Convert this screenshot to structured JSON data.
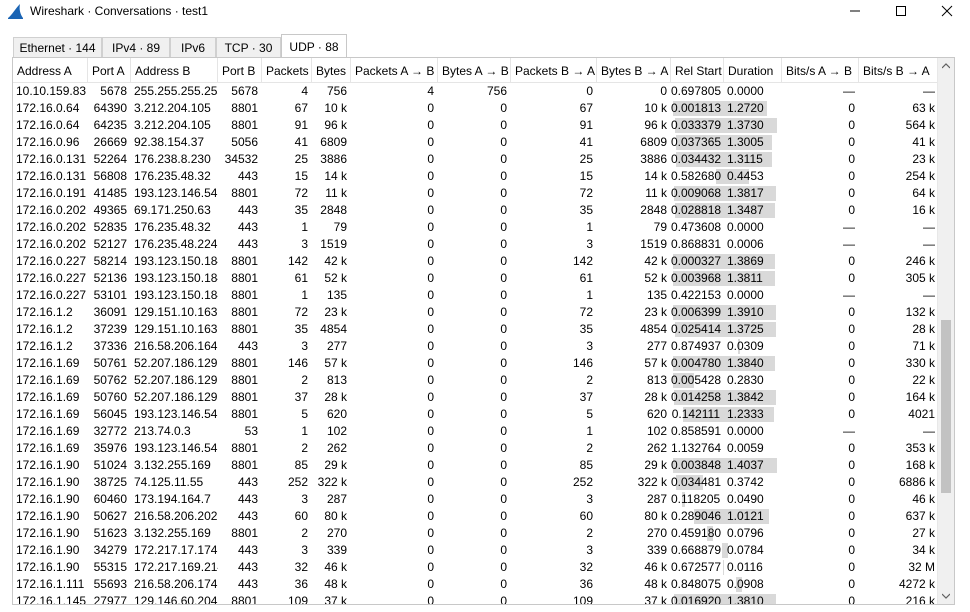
{
  "window": {
    "title": "Wireshark · Conversations · test1",
    "minimize_glyph": "—",
    "maximize_glyph": "☐",
    "close_glyph": "✕",
    "icon": "wireshark-fin-icon",
    "accent": "#1a64b4"
  },
  "tabs": [
    {
      "label": "Ethernet · 144",
      "active": false
    },
    {
      "label": "IPv4 · 89",
      "active": false
    },
    {
      "label": "IPv6",
      "active": false
    },
    {
      "label": "TCP · 30",
      "active": false
    },
    {
      "label": "UDP · 88",
      "active": true
    }
  ],
  "table": {
    "columns": [
      "Address A",
      "Port A",
      "Address B",
      "Port B",
      "Packets",
      "Bytes",
      "Packets A → B",
      "Bytes A → B",
      "Packets B → A",
      "Bytes B → A",
      "Rel Start",
      "Duration",
      "Bits/s A → B",
      "Bits/s B → A"
    ],
    "rows": [
      [
        "10.10.159.83",
        "5678",
        "255.255.255.255",
        "5678",
        "4",
        "756",
        "4",
        "756",
        "0",
        "0",
        "0.697805",
        "0.0000",
        "—",
        "—"
      ],
      [
        "172.16.0.64",
        "64390",
        "3.212.204.105",
        "8801",
        "67",
        "10 k",
        "0",
        "0",
        "67",
        "10 k",
        "0.001813",
        "1.2720",
        "0",
        "63 k"
      ],
      [
        "172.16.0.64",
        "64235",
        "3.212.204.105",
        "8801",
        "91",
        "96 k",
        "0",
        "0",
        "91",
        "96 k",
        "0.033379",
        "1.3730",
        "0",
        "564 k"
      ],
      [
        "172.16.0.96",
        "26669",
        "92.38.154.37",
        "5056",
        "41",
        "6809",
        "0",
        "0",
        "41",
        "6809",
        "0.037365",
        "1.3005",
        "0",
        "41 k"
      ],
      [
        "172.16.0.131",
        "52264",
        "176.238.8.230",
        "34532",
        "25",
        "3886",
        "0",
        "0",
        "25",
        "3886",
        "0.034432",
        "1.3115",
        "0",
        "23 k"
      ],
      [
        "172.16.0.131",
        "56808",
        "176.235.48.32",
        "443",
        "15",
        "14 k",
        "0",
        "0",
        "15",
        "14 k",
        "0.582680",
        "0.4453",
        "0",
        "254 k"
      ],
      [
        "172.16.0.191",
        "41485",
        "193.123.146.54",
        "8801",
        "72",
        "11 k",
        "0",
        "0",
        "72",
        "11 k",
        "0.009068",
        "1.3817",
        "0",
        "64 k"
      ],
      [
        "172.16.0.202",
        "49365",
        "69.171.250.63",
        "443",
        "35",
        "2848",
        "0",
        "0",
        "35",
        "2848",
        "0.028818",
        "1.3487",
        "0",
        "16 k"
      ],
      [
        "172.16.0.202",
        "52835",
        "176.235.48.32",
        "443",
        "1",
        "79",
        "0",
        "0",
        "1",
        "79",
        "0.473608",
        "0.0000",
        "—",
        "—"
      ],
      [
        "172.16.0.202",
        "52127",
        "176.235.48.224",
        "443",
        "3",
        "1519",
        "0",
        "0",
        "3",
        "1519",
        "0.868831",
        "0.0006",
        "—",
        "—"
      ],
      [
        "172.16.0.227",
        "58214",
        "193.123.150.184",
        "8801",
        "142",
        "42 k",
        "0",
        "0",
        "142",
        "42 k",
        "0.000327",
        "1.3869",
        "0",
        "246 k"
      ],
      [
        "172.16.0.227",
        "52136",
        "193.123.150.184",
        "8801",
        "61",
        "52 k",
        "0",
        "0",
        "61",
        "52 k",
        "0.003968",
        "1.3811",
        "0",
        "305 k"
      ],
      [
        "172.16.0.227",
        "53101",
        "193.123.150.184",
        "8801",
        "1",
        "135",
        "0",
        "0",
        "1",
        "135",
        "0.422153",
        "0.0000",
        "—",
        "—"
      ],
      [
        "172.16.1.2",
        "36091",
        "129.151.10.163",
        "8801",
        "72",
        "23 k",
        "0",
        "0",
        "72",
        "23 k",
        "0.006399",
        "1.3910",
        "0",
        "132 k"
      ],
      [
        "172.16.1.2",
        "37239",
        "129.151.10.163",
        "8801",
        "35",
        "4854",
        "0",
        "0",
        "35",
        "4854",
        "0.025414",
        "1.3725",
        "0",
        "28 k"
      ],
      [
        "172.16.1.2",
        "37336",
        "216.58.206.164",
        "443",
        "3",
        "277",
        "0",
        "0",
        "3",
        "277",
        "0.874937",
        "0.0309",
        "0",
        "71 k"
      ],
      [
        "172.16.1.69",
        "50761",
        "52.207.186.129",
        "8801",
        "146",
        "57 k",
        "0",
        "0",
        "146",
        "57 k",
        "0.004780",
        "1.3840",
        "0",
        "330 k"
      ],
      [
        "172.16.1.69",
        "50762",
        "52.207.186.129",
        "8801",
        "2",
        "813",
        "0",
        "0",
        "2",
        "813",
        "0.005428",
        "0.2830",
        "0",
        "22 k"
      ],
      [
        "172.16.1.69",
        "50760",
        "52.207.186.129",
        "8801",
        "37",
        "28 k",
        "0",
        "0",
        "37",
        "28 k",
        "0.014258",
        "1.3842",
        "0",
        "164 k"
      ],
      [
        "172.16.1.69",
        "56045",
        "193.123.146.54",
        "8801",
        "5",
        "620",
        "0",
        "0",
        "5",
        "620",
        "0.142111",
        "1.2333",
        "0",
        "4021"
      ],
      [
        "172.16.1.69",
        "32772",
        "213.74.0.3",
        "53",
        "1",
        "102",
        "0",
        "0",
        "1",
        "102",
        "0.858591",
        "0.0000",
        "—",
        "—"
      ],
      [
        "172.16.1.69",
        "35976",
        "193.123.146.54",
        "8801",
        "2",
        "262",
        "0",
        "0",
        "2",
        "262",
        "1.132764",
        "0.0059",
        "0",
        "353 k"
      ],
      [
        "172.16.1.90",
        "51024",
        "3.132.255.169",
        "8801",
        "85",
        "29 k",
        "0",
        "0",
        "85",
        "29 k",
        "0.003848",
        "1.4037",
        "0",
        "168 k"
      ],
      [
        "172.16.1.90",
        "38725",
        "74.125.11.55",
        "443",
        "252",
        "322 k",
        "0",
        "0",
        "252",
        "322 k",
        "0.034481",
        "0.3742",
        "0",
        "6886 k"
      ],
      [
        "172.16.1.90",
        "60460",
        "173.194.164.7",
        "443",
        "3",
        "287",
        "0",
        "0",
        "3",
        "287",
        "0.118205",
        "0.0490",
        "0",
        "46 k"
      ],
      [
        "172.16.1.90",
        "50627",
        "216.58.206.202",
        "443",
        "60",
        "80 k",
        "0",
        "0",
        "60",
        "80 k",
        "0.289046",
        "1.0121",
        "0",
        "637 k"
      ],
      [
        "172.16.1.90",
        "51623",
        "3.132.255.169",
        "8801",
        "2",
        "270",
        "0",
        "0",
        "2",
        "270",
        "0.459180",
        "0.0796",
        "0",
        "27 k"
      ],
      [
        "172.16.1.90",
        "34279",
        "172.217.17.174",
        "443",
        "3",
        "339",
        "0",
        "0",
        "3",
        "339",
        "0.668879",
        "0.0784",
        "0",
        "34 k"
      ],
      [
        "172.16.1.90",
        "55315",
        "172.217.169.214",
        "443",
        "32",
        "46 k",
        "0",
        "0",
        "32",
        "46 k",
        "0.672577",
        "0.0116",
        "0",
        "32 M"
      ],
      [
        "172.16.1.111",
        "55693",
        "216.58.206.174",
        "443",
        "36",
        "48 k",
        "0",
        "0",
        "36",
        "48 k",
        "0.848075",
        "0.0908",
        "0",
        "4272 k"
      ],
      [
        "172.16.1.145",
        "27977",
        "129.146.60.204",
        "8801",
        "109",
        "37 k",
        "0",
        "0",
        "109",
        "37 k",
        "0.016920",
        "1.3810",
        "0",
        "216 k"
      ]
    ]
  },
  "scrollbar": {
    "up_glyph": "▲",
    "down_glyph": "▼",
    "position_fraction": 0.48
  },
  "colors": {
    "bar_fill": "#d9d9d9",
    "tab_bg": "#f0f0f0"
  }
}
